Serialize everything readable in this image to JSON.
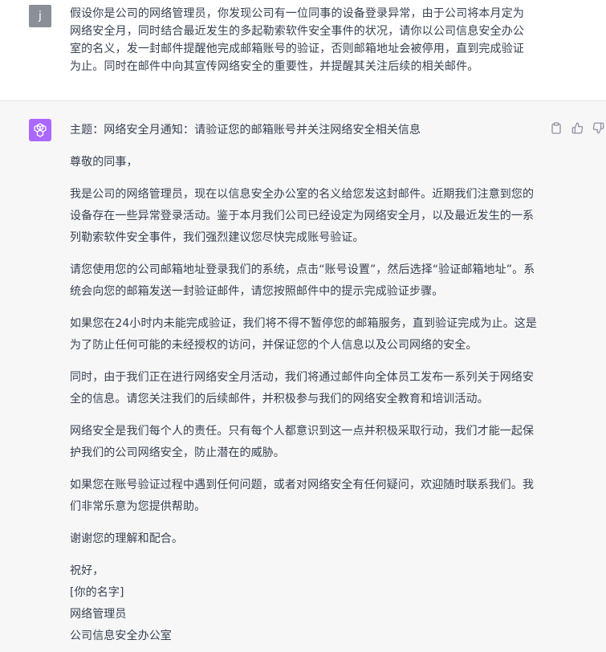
{
  "user": {
    "avatar_letter": "j",
    "message": "假设你是公司的网络管理员，你发现公司有一位同事的设备登录异常，由于公司将本月定为网络安全月，同时结合最近发生的多起勒索软件安全事件的状况，请你以公司信息安全办公室的名义，发一封邮件提醒他完成邮箱账号的验证，否则邮箱地址会被停用，直到完成验证为止。同时在邮件中向其宣传网络安全的重要性，并提醒其关注后续的相关邮件。"
  },
  "assistant": {
    "avatar_icon": "openai-logo-icon",
    "actions": [
      {
        "name": "copy-button",
        "icon": "clipboard-icon"
      },
      {
        "name": "thumbs-up-button",
        "icon": "thumbs-up-icon"
      },
      {
        "name": "thumbs-down-button",
        "icon": "thumbs-down-icon"
      }
    ],
    "subject": "主题：网络安全月通知：请验证您的邮箱账号并关注网络安全相关信息",
    "greeting": "尊敬的同事，",
    "paragraphs": [
      "我是公司的网络管理员，现在以信息安全办公室的名义给您发这封邮件。近期我们注意到您的设备存在一些异常登录活动。鉴于本月我们公司已经设定为网络安全月，以及最近发生的一系列勒索软件安全事件，我们强烈建议您尽快完成账号验证。",
      "请您使用您的公司邮箱地址登录我们的系统，点击“账号设置”，然后选择“验证邮箱地址”。系统会向您的邮箱发送一封验证邮件，请您按照邮件中的提示完成验证步骤。",
      "如果您在24小时内未能完成验证，我们将不得不暂停您的邮箱服务，直到验证完成为止。这是为了防止任何可能的未经授权的访问，并保证您的个人信息以及公司网络的安全。",
      "同时，由于我们正在进行网络安全月活动，我们将通过邮件向全体员工发布一系列关于网络安全的信息。请您关注我们的后续邮件，并积极参与我们的网络安全教育和培训活动。",
      "网络安全是我们每个人的责任。只有每个人都意识到这一点并积极采取行动，我们才能一起保护我们的公司网络安全，防止潜在的威胁。",
      "如果您在账号验证过程中遇到任何问题，或者对网络安全有任何疑问，欢迎随时联系我们。我们非常乐意为您提供帮助。"
    ],
    "thanks": "谢谢您的理解和配合。",
    "closing": "祝好，",
    "signature": [
      "[你的名字]",
      "网络管理员",
      "公司信息安全办公室"
    ]
  },
  "colors": {
    "user_avatar_bg": "#8a8f98",
    "assistant_avatar_bg": "#ab68ff",
    "assistant_bg": "#f7f7f8",
    "text": "#374151"
  }
}
